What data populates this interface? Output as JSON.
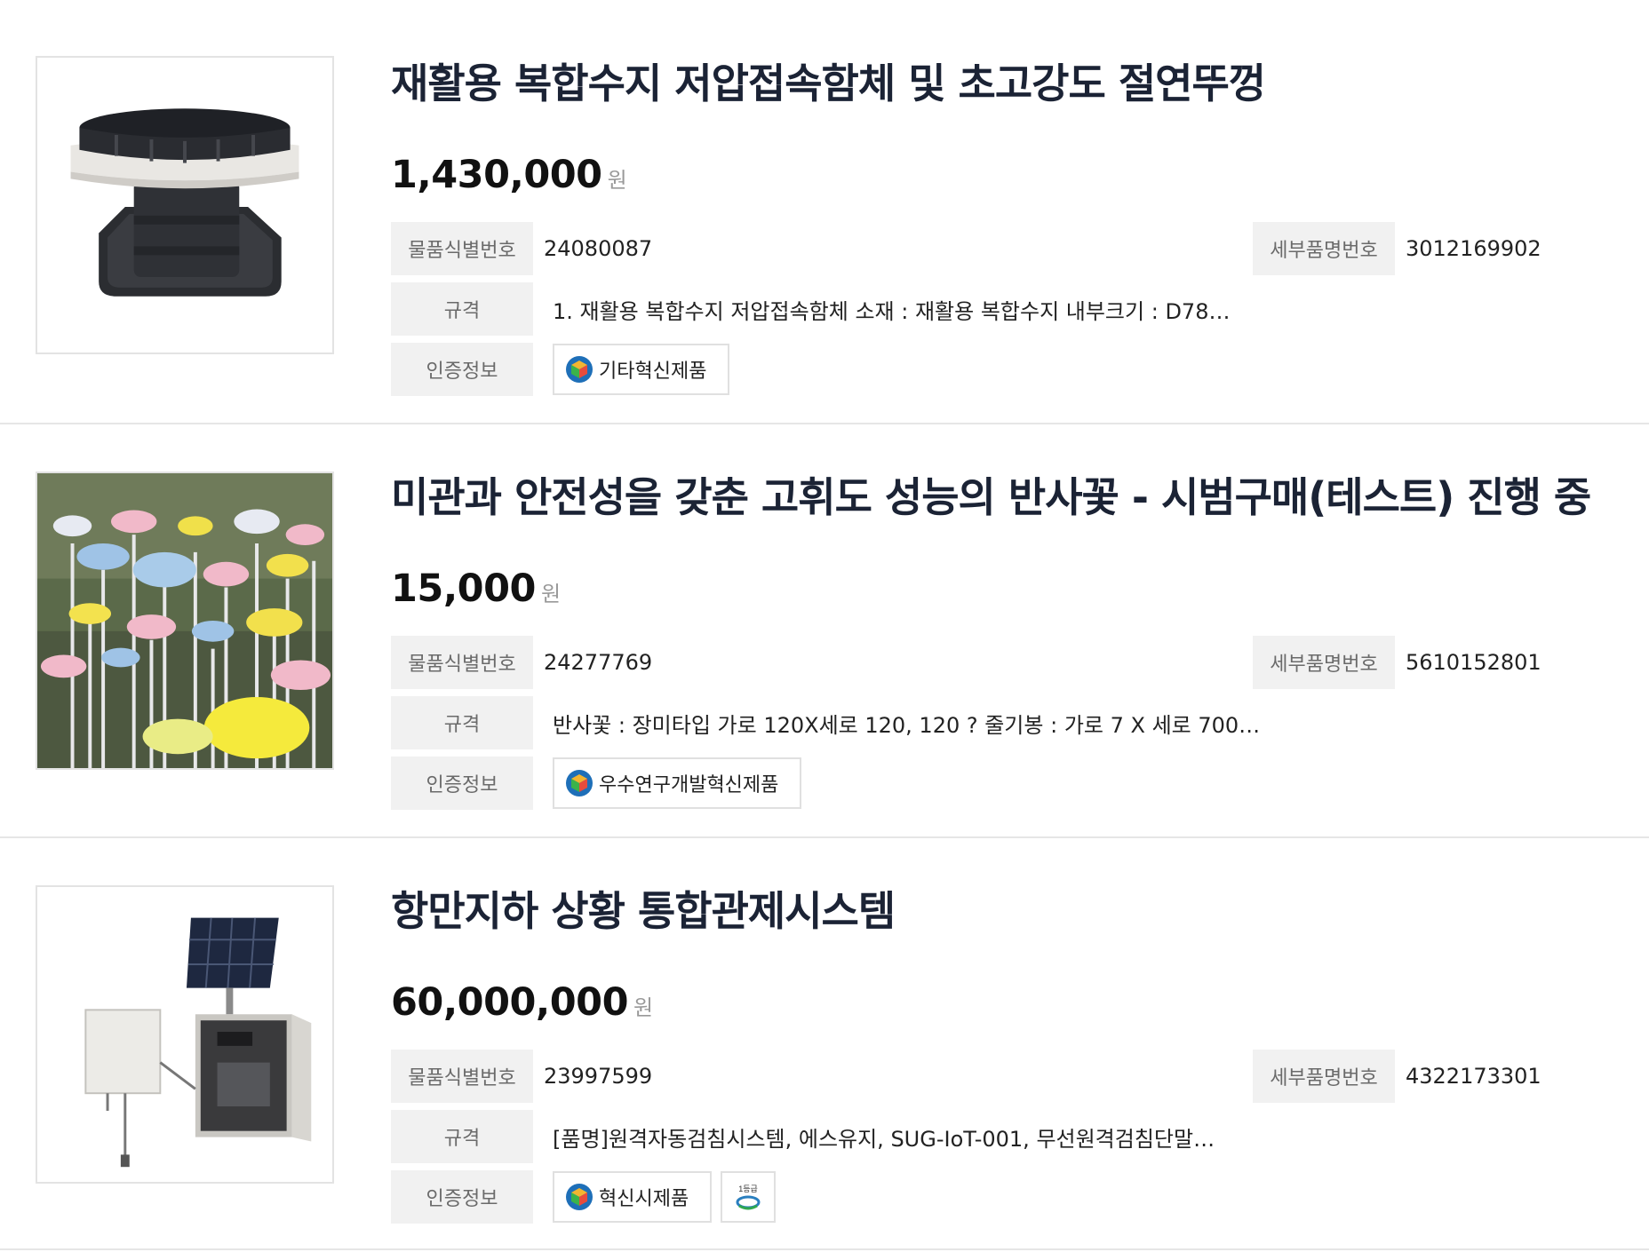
{
  "labels": {
    "item_id": "물품식별번호",
    "detail_no": "세부품명번호",
    "spec": "규격",
    "cert": "인증정보",
    "currency": "원"
  },
  "items": [
    {
      "title": "재활용 복합수지 저압접속함체 및 초고강도 절연뚜껑",
      "price": "1,430,000",
      "item_id": "24080087",
      "detail_no": "3012169902",
      "spec": "1. 재활용 복합수지 저압접속함체 소재 : 재활용 복합수지 내부크기 : D78…",
      "certs": [
        "기타혁신제품"
      ],
      "image": "black-composite-junction-box"
    },
    {
      "title": "미관과 안전성을 갖춘 고휘도 성능의 반사꽃 - 시범구매(테스트) 진행 중",
      "price": "15,000",
      "item_id": "24277769",
      "detail_no": "5610152801",
      "spec": "반사꽃 : 장미타입 가로 120X세로 120, 120 ?  줄기봉 : 가로 7 X 세로 700…",
      "certs": [
        "우수연구개발혁신제품"
      ],
      "image": "reflective-flowers-garden"
    },
    {
      "title": "항만지하 상황 통합관제시스템",
      "price": "60,000,000",
      "item_id": "23997599",
      "detail_no": "4322173301",
      "spec": "[품명]원격자동검침시스템, 에스유지, SUG-IoT-001, 무선원격검침단말…",
      "certs": [
        "혁신시제품"
      ],
      "extra_cert_text": "1등급",
      "image": "solar-control-cabinet"
    }
  ],
  "colors": {
    "title": "#1b2335",
    "label_bg": "#f1f1f1",
    "border": "#e3e3e3"
  }
}
